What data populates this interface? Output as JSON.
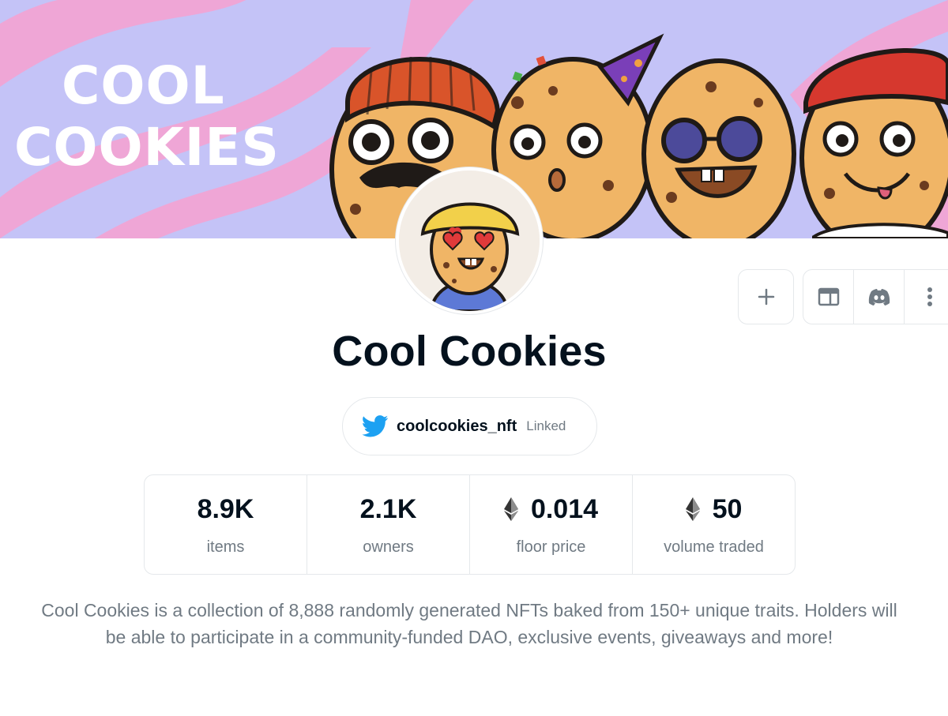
{
  "banner": {
    "title_line1": "COOL",
    "title_line2": "COOKIES",
    "colors": {
      "background": "#c4c3f7",
      "stripe": "#efa6d6",
      "cookie": "#f0b566",
      "outline": "#1f1a17"
    }
  },
  "avatar": {
    "icon": "cookie-avatar-icon"
  },
  "actions": {
    "add_icon": "plus-icon",
    "website_icon": "website-icon",
    "discord_icon": "discord-icon",
    "more_icon": "more-vertical-icon"
  },
  "collection": {
    "title": "Cool Cookies",
    "twitter": {
      "handle": "coolcookies_nft",
      "status": "Linked",
      "icon": "twitter-icon",
      "color": "#1da1f2"
    },
    "stats": [
      {
        "value": "8.9K",
        "label": "items",
        "eth": false
      },
      {
        "value": "2.1K",
        "label": "owners",
        "eth": false
      },
      {
        "value": "0.014",
        "label": "floor price",
        "eth": true
      },
      {
        "value": "50",
        "label": "volume traded",
        "eth": true
      }
    ],
    "description": "Cool Cookies is a collection of 8,888 randomly generated NFTs baked from 150+ unique traits. Holders will be able to participate in a community-funded DAO, exclusive events, giveaways and more!"
  }
}
